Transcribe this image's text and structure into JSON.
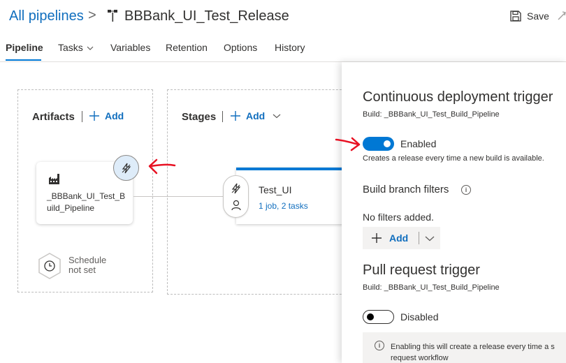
{
  "header": {
    "breadcrumb": "All pipelines",
    "separator": ">",
    "pipeline_name": "BBBank_UI_Test_Release",
    "save_label": "Save"
  },
  "tabs": [
    {
      "label": "Pipeline",
      "active": true
    },
    {
      "label": "Tasks",
      "has_dropdown": true
    },
    {
      "label": "Variables"
    },
    {
      "label": "Retention"
    },
    {
      "label": "Options"
    },
    {
      "label": "History"
    }
  ],
  "artifacts": {
    "title": "Artifacts",
    "add_label": "Add",
    "card_name": "_BBBank_UI_Test_Build_Pipeline",
    "schedule_line1": "Schedule",
    "schedule_line2": "not set"
  },
  "stages": {
    "title": "Stages",
    "add_label": "Add",
    "stage_name": "Test_UI",
    "stage_jobs": "1 job, 2 tasks"
  },
  "panel": {
    "cd_title": "Continuous deployment trigger",
    "cd_build": "Build: _BBBank_UI_Test_Build_Pipeline",
    "cd_toggle_label": "Enabled",
    "cd_toggle_on": true,
    "cd_desc": "Creates a release every time a new build is available.",
    "branch_title": "Build branch filters",
    "no_filters": "No filters added.",
    "add_label": "Add",
    "pr_title": "Pull request trigger",
    "pr_build": "Build: _BBBank_UI_Test_Build_Pipeline",
    "pr_toggle_label": "Disabled",
    "pr_toggle_on": false,
    "pr_info_line1": "Enabling this will create a release every time a s",
    "pr_info_line2": "request workflow"
  },
  "colors": {
    "accent": "#0078d4",
    "link": "#106ebe",
    "annotation": "#e81123"
  }
}
